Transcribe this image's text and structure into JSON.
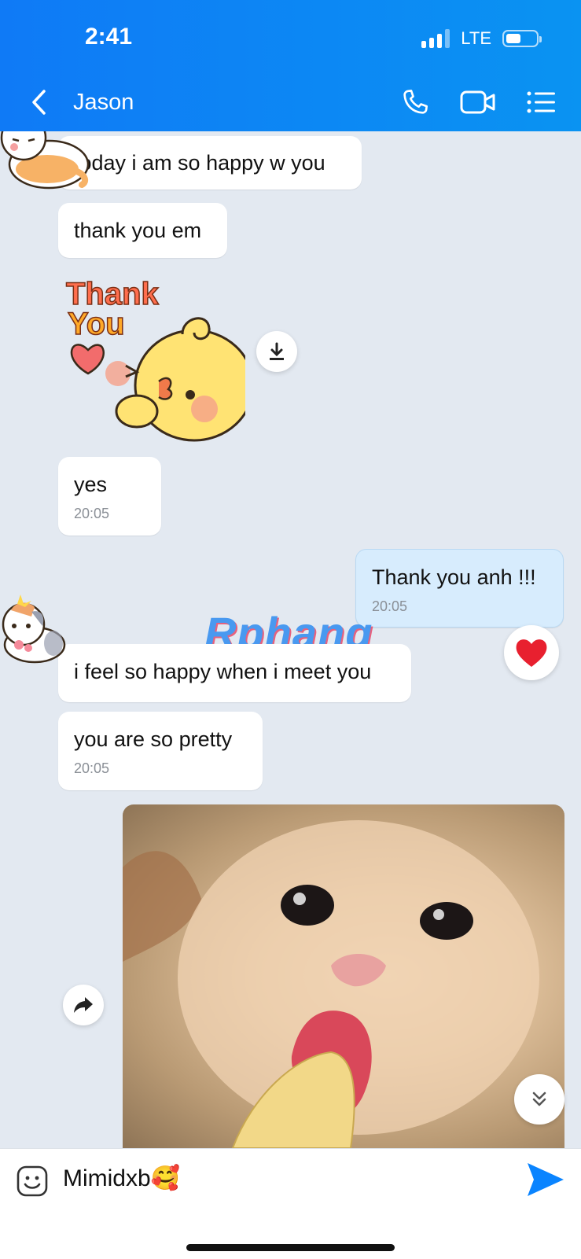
{
  "status": {
    "time": "2:41",
    "network": "LTE"
  },
  "header": {
    "title": "Jason"
  },
  "messages": {
    "m1": {
      "text": "today i am so happy w you"
    },
    "m2": {
      "text": "thank you em"
    },
    "sticker": {
      "line1": "Thank",
      "line2": "You"
    },
    "m3": {
      "text": "yes",
      "time": "20:05"
    },
    "m4": {
      "text": "Thank you anh !!!",
      "time": "20:05"
    },
    "m5": {
      "text": "i feel so happy when i meet you"
    },
    "m6": {
      "text": "you are so pretty",
      "time": "20:05"
    }
  },
  "watermark": "Rphang",
  "composer": {
    "value": "Mimidxb🥰"
  },
  "colors": {
    "header": "#0f7af6",
    "send": "#0a84ff",
    "mine_bubble": "#d7ecfd",
    "background": "#e3e9f1"
  }
}
